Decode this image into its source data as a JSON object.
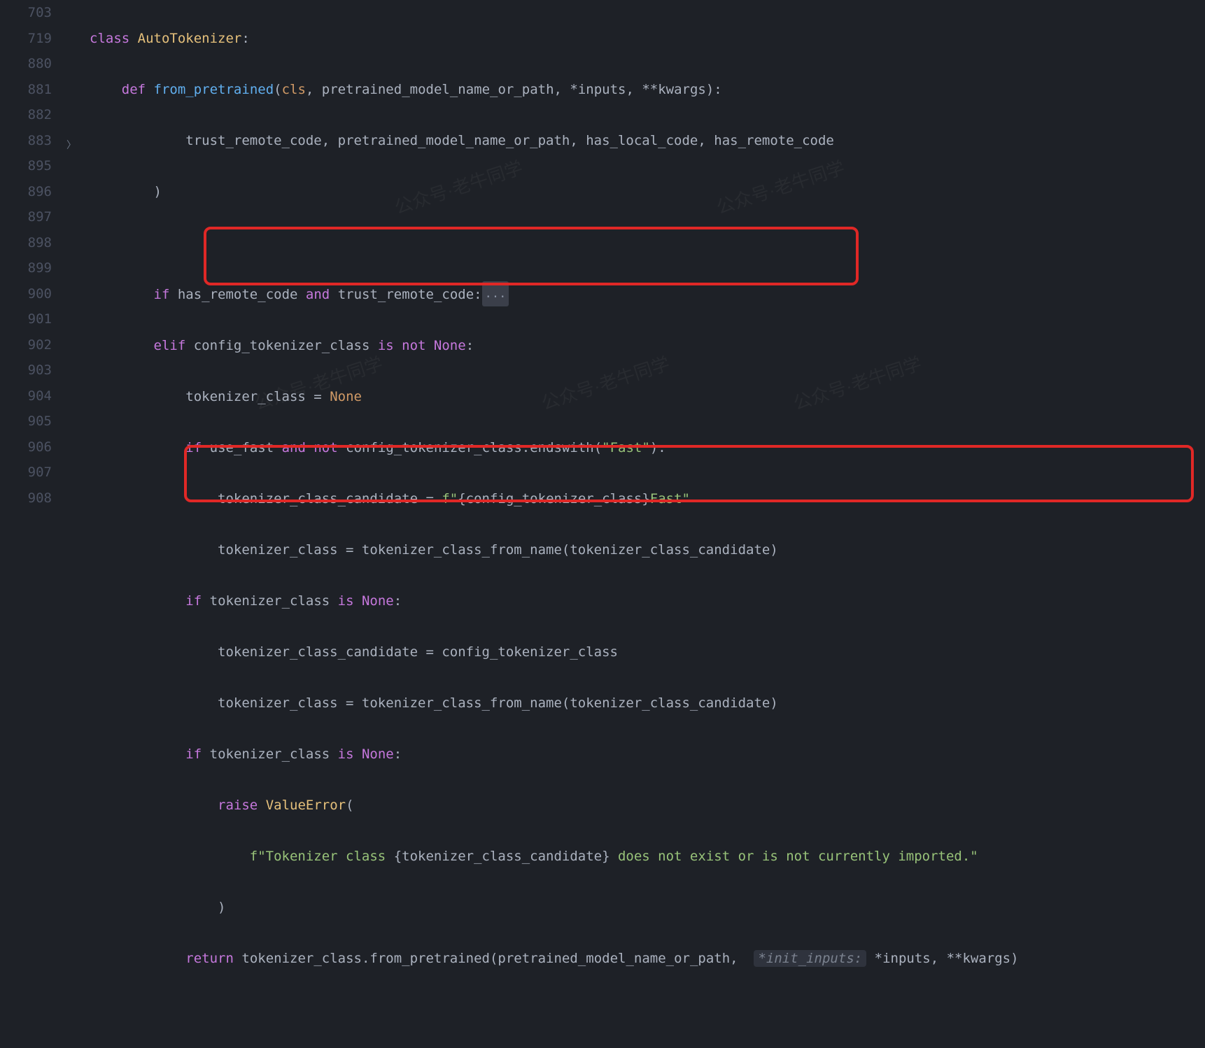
{
  "line_numbers": [
    "703",
    "719",
    "880",
    "881",
    "882",
    "883",
    "895",
    "896",
    "897",
    "898",
    "899",
    "900",
    "901",
    "902",
    "903",
    "904",
    "905",
    "906",
    "907",
    "908"
  ],
  "code": {
    "l0": "class AutoTokenizer:",
    "l1_def": "def",
    "l1_fn": "from_pretrained",
    "l1_rest": "(cls, pretrained_model_name_or_path, *inputs, **kwargs):",
    "l2": "trust_remote_code, pretrained_model_name_or_path, has_local_code, has_remote_code",
    "l3": ")",
    "l5a": "if",
    "l5b": "has_remote_code",
    "l5c": "and",
    "l5d": "trust_remote_code:",
    "l5fold": "...",
    "l6a": "elif",
    "l6b": "config_tokenizer_class",
    "l6c": "is not None",
    "l7a": "tokenizer_class =",
    "l7b": "None",
    "l8a": "if",
    "l8b": "use_fast",
    "l8c": "and not",
    "l8d": "config_tokenizer_class.endswith(",
    "l8e": "\"Fast\"",
    "l8f": "):",
    "l9a": "tokenizer_class_candidate =",
    "l9b": "f\"",
    "l9c": "{config_tokenizer_class}",
    "l9d": "Fast\"",
    "l10": "tokenizer_class = tokenizer_class_from_name(tokenizer_class_candidate)",
    "l11a": "if",
    "l11b": "tokenizer_class",
    "l11c": "is None",
    "l12": "tokenizer_class_candidate = config_tokenizer_class",
    "l13": "tokenizer_class = tokenizer_class_from_name(tokenizer_class_candidate)",
    "l14a": "if",
    "l14b": "tokenizer_class",
    "l14c": "is None",
    "l15a": "raise",
    "l15b": "ValueError",
    "l15c": "(",
    "l16a": "f\"Tokenizer class ",
    "l16b": "{tokenizer_class_candidate}",
    "l16c": " does not exist or is not currently imported.\"",
    "l17": ")",
    "l18a": "return",
    "l18b": "tokenizer_class.from_pretrained(pretrained_model_name_or_path,",
    "l18hint": "*init_inputs:",
    "l18c": "*inputs, **kwargs)"
  },
  "watermark": "公众号·老牛同学"
}
